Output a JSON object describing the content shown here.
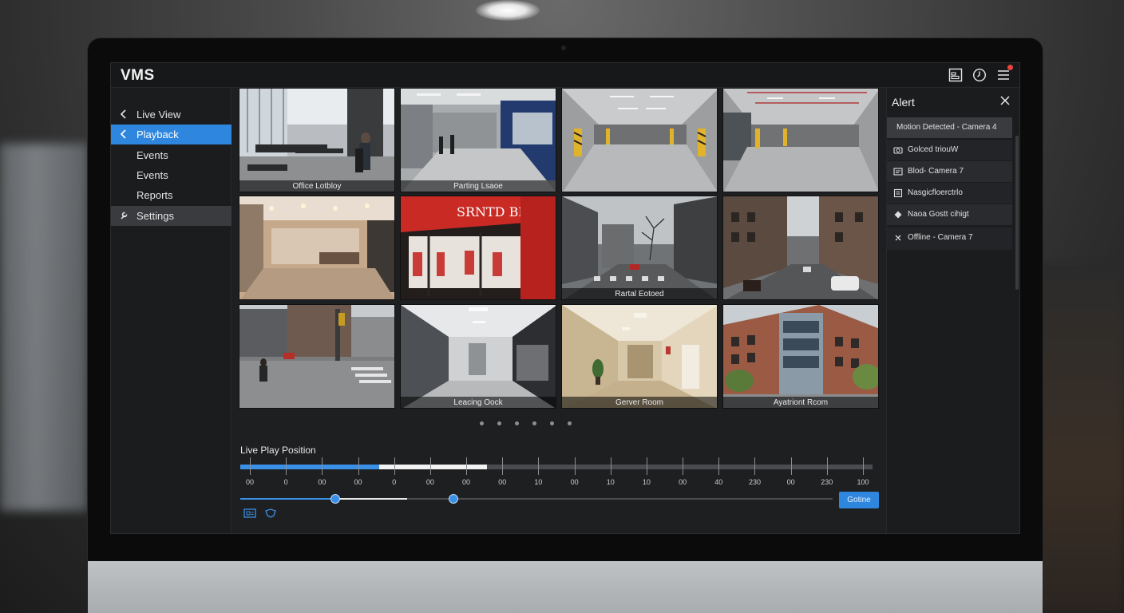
{
  "app": {
    "title": "VMS"
  },
  "header": {
    "icons": [
      "layout-icon",
      "clock-icon",
      "menu-icon"
    ],
    "notification_color": "#e8453c"
  },
  "sidebar": {
    "items": [
      {
        "label": "Live View",
        "icon": "chevron-left-icon",
        "state": "normal"
      },
      {
        "label": "Playback",
        "icon": "chevron-left-icon",
        "state": "active"
      },
      {
        "label": "Events",
        "icon": "",
        "state": "normal"
      },
      {
        "label": "Events",
        "icon": "",
        "state": "normal"
      },
      {
        "label": "Reports",
        "icon": "",
        "state": "normal"
      },
      {
        "label": "Settings",
        "icon": "wrench-icon",
        "state": "highlight"
      }
    ]
  },
  "cameras": [
    {
      "caption": "Office Lotbloy",
      "scene": "office"
    },
    {
      "caption": "Parting Lsaoe",
      "scene": "lobby"
    },
    {
      "caption": "",
      "scene": "garage"
    },
    {
      "caption": "",
      "scene": "garage"
    },
    {
      "caption": "",
      "scene": "mall"
    },
    {
      "caption": "",
      "scene": "store",
      "sign": "SRNTD BEY"
    },
    {
      "caption": "Rartal Eotoed",
      "scene": "street"
    },
    {
      "caption": "",
      "scene": "street"
    },
    {
      "caption": "",
      "scene": "crosswalk"
    },
    {
      "caption": "Leacing Oock",
      "scene": "corridor"
    },
    {
      "caption": "Gerver Room",
      "scene": "hallway"
    },
    {
      "caption": "Ayatriont Rcom",
      "scene": "building"
    }
  ],
  "pager": {
    "pages": 6
  },
  "timeline": {
    "label": "Live Play Position",
    "tick_labels": [
      "00",
      "0",
      "00",
      "00",
      "0",
      "00",
      "00",
      "00",
      "10",
      "00",
      "10",
      "10",
      "00",
      "40",
      "230",
      "00",
      "230",
      "100"
    ],
    "played_fraction": 0.22,
    "buffered_fraction": 0.39,
    "scrub_positions": [
      0.16,
      0.36
    ],
    "go_label": "Gotine",
    "accent": "#2f86de"
  },
  "alerts": {
    "title": "Alert",
    "items": [
      {
        "text": "Motion Detected - Camera 4",
        "icon": ""
      },
      {
        "text": "Golced triouW",
        "icon": "camera-icon"
      },
      {
        "text": "Blod- Camera 7",
        "icon": "camera-icon"
      },
      {
        "text": "Nasgicfloerctrlo",
        "icon": "document-icon"
      },
      {
        "text": "Naoa Gostt cihigt",
        "icon": "warning-icon"
      },
      {
        "text": "Offline - Camera 7",
        "icon": "offline-icon"
      }
    ]
  }
}
